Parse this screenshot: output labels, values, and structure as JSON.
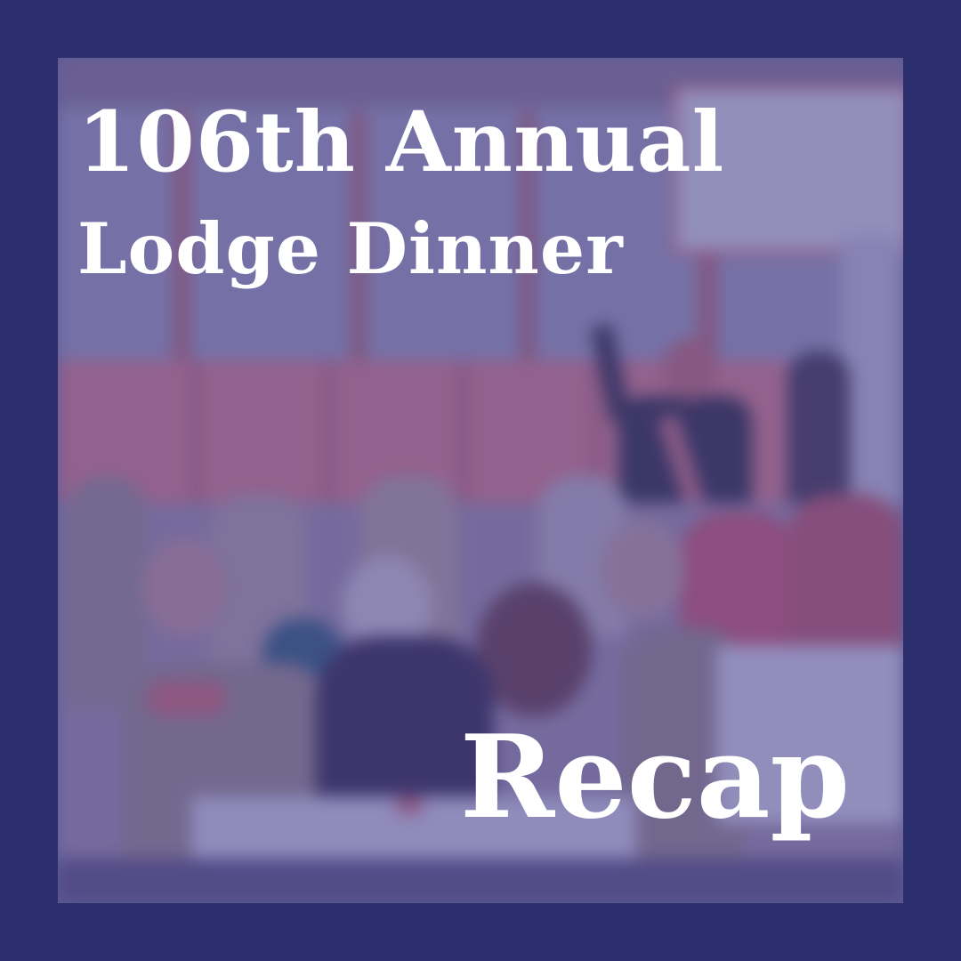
{
  "graphic": {
    "title_line_1": "106th Annual",
    "title_line_2": "Lodge Dinner",
    "subtitle": "Recap"
  },
  "colors": {
    "border": "#2b2f6e",
    "tint": "#3c3a8c",
    "text": "#ffffff"
  },
  "background_photo": {
    "description_icon": "blurred-photo"
  }
}
